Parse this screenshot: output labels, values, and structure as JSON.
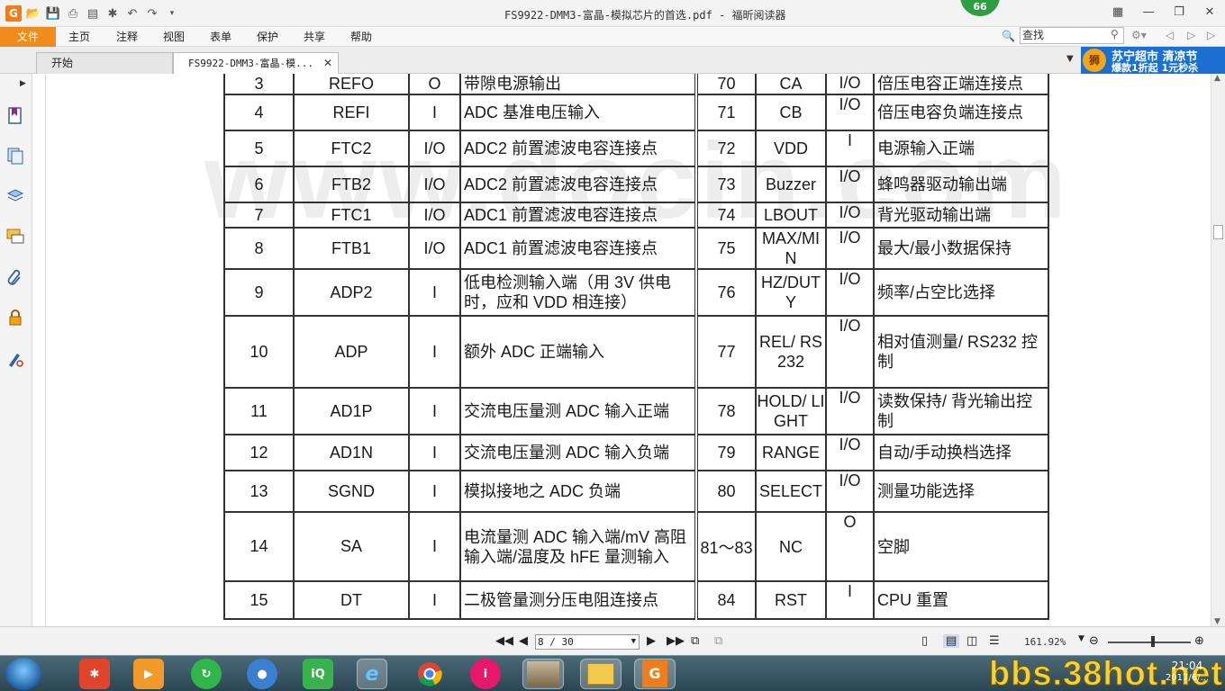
{
  "window": {
    "title": "FS9922-DMM3-富晶-模拟芯片的首选.pdf - 福昕阅读器",
    "badge": "66"
  },
  "menu": {
    "file": "文件",
    "items": [
      "主页",
      "注释",
      "视图",
      "表单",
      "保护",
      "共享",
      "帮助"
    ],
    "search_placeholder": "查找"
  },
  "tabs": [
    {
      "label": "开始"
    },
    {
      "label": "FS9922-DMM3-富晶-模..."
    }
  ],
  "ad": {
    "line1": "苏宁超市 清凉节",
    "line2": "爆款1折起 1元秒杀",
    "logo": "狮"
  },
  "document": {
    "watermark": "www.docin.com",
    "rows": [
      {
        "no": "3",
        "name": "REFO",
        "io": "O",
        "desc": "带隙电源输出",
        "no2": "70",
        "name2": "CA",
        "io2": "I/O",
        "desc2": "倍压电容正端连接点"
      },
      {
        "no": "4",
        "name": "REFI",
        "io": "I",
        "desc": "ADC 基准电压输入",
        "no2": "71",
        "name2": "CB",
        "io2": "I/O",
        "desc2": "倍压电容负端连接点"
      },
      {
        "no": "5",
        "name": "FTC2",
        "io": "I/O",
        "desc": "ADC2 前置滤波电容连接点",
        "no2": "72",
        "name2": "VDD",
        "io2": "I",
        "desc2": "电源输入正端"
      },
      {
        "no": "6",
        "name": "FTB2",
        "io": "I/O",
        "desc": "ADC2 前置滤波电容连接点",
        "no2": "73",
        "name2": "Buzzer",
        "io2": "I/O",
        "desc2": "蜂鸣器驱动输出端"
      },
      {
        "no": "7",
        "name": "FTC1",
        "io": "I/O",
        "desc": "ADC1 前置滤波电容连接点",
        "no2": "74",
        "name2": "LBOUT",
        "io2": "I/O",
        "desc2": "背光驱动输出端"
      },
      {
        "no": "8",
        "name": "FTB1",
        "io": "I/O",
        "desc": "ADC1 前置滤波电容连接点",
        "no2": "75",
        "name2": "MAX/MIN",
        "io2": "I/O",
        "desc2": "最大/最小数据保持"
      },
      {
        "no": "9",
        "name": "ADP2",
        "io": "I",
        "desc": "低电检测输入端（用 3V 供电时，应和 VDD 相连接）",
        "no2": "76",
        "name2": "HZ/DUTY",
        "io2": "I/O",
        "desc2": "频率/占空比选择"
      },
      {
        "no": "10",
        "name": "ADP",
        "io": "I",
        "desc": "额外 ADC 正端输入",
        "no2": "77",
        "name2": "REL/ RS232",
        "io2": "I/O",
        "desc2": "相对值测量/ RS232 控制"
      },
      {
        "no": "11",
        "name": "AD1P",
        "io": "I",
        "desc": "交流电压量测 ADC 输入正端",
        "no2": "78",
        "name2": "HOLD/ LIGHT",
        "io2": "I/O",
        "desc2": "读数保持/ 背光输出控制"
      },
      {
        "no": "12",
        "name": "AD1N",
        "io": "I",
        "desc": "交流电压量测 ADC 输入负端",
        "no2": "79",
        "name2": "RANGE",
        "io2": "I/O",
        "desc2": "自动/手动换档选择"
      },
      {
        "no": "13",
        "name": "SGND",
        "io": "I",
        "desc": "模拟接地之 ADC 负端",
        "no2": "80",
        "name2": "SELECT",
        "io2": "I/O",
        "desc2": "测量功能选择"
      },
      {
        "no": "14",
        "name": "SA",
        "io": "I",
        "desc": "电流量测 ADC 输入端/mV 高阻输入端/温度及 hFE 量测输入",
        "no2": "81～83",
        "name2": "NC",
        "io2": "O",
        "desc2": "空脚"
      },
      {
        "no": "15",
        "name": "DT",
        "io": "I",
        "desc": "二极管量测分压电阻连接点",
        "no2": "84",
        "name2": "RST",
        "io2": "I",
        "desc2": "CPU 重置"
      }
    ]
  },
  "status": {
    "page": "8 / 30",
    "zoom": "161.92%"
  },
  "taskbar": {
    "clock_time": "21:04",
    "clock_date": "2017/6/...",
    "watermark": "bbs.38hot.net"
  }
}
